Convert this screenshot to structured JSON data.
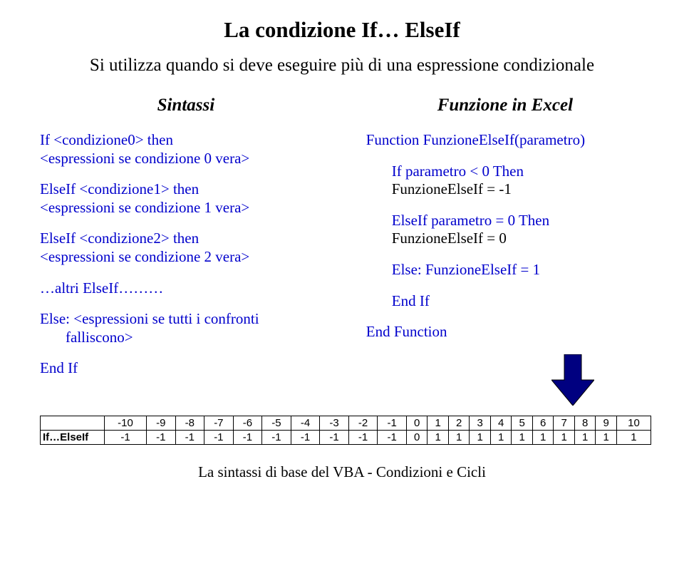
{
  "title": "La condizione If… ElseIf",
  "subtitle": "Si utilizza quando si deve eseguire più di una espressione condizionale",
  "left": {
    "header": "Sintassi",
    "if_then": "If  <condizione0> then",
    "if_body": "<espressioni se condizione 0 vera>",
    "elif1_then": "ElseIf <condizione1> then",
    "elif1_body": "<espressioni se condizione 1 vera>",
    "elif2_then": "ElseIf <condizione2> then",
    "elif2_body": "<espressioni se condizione 2 vera>",
    "others": "…altri ElseIf………",
    "else_kw": "Else:",
    "else_body_l1": " <espressioni se tutti i confronti",
    "else_body_l2": "falliscono>",
    "endif": "End If"
  },
  "right": {
    "header": "Funzione in Excel",
    "fn_decl": "Function FunzioneElseIf(parametro)",
    "if_then": "If parametro < 0 Then",
    "if_body": "FunzioneElseIf = -1",
    "elif_then": "ElseIf parametro = 0 Then",
    "elif_body": "FunzioneElseIf = 0",
    "else_line": "Else: FunzioneElseIf = 1",
    "endif": "End If",
    "end_fn": "End Function"
  },
  "table": {
    "headers": [
      "-10",
      "-9",
      "-8",
      "-7",
      "-6",
      "-5",
      "-4",
      "-3",
      "-2",
      "-1",
      "0",
      "1",
      "2",
      "3",
      "4",
      "5",
      "6",
      "7",
      "8",
      "9",
      "10"
    ],
    "row_label": "If…ElseIf",
    "row_values": [
      "-1",
      "-1",
      "-1",
      "-1",
      "-1",
      "-1",
      "-1",
      "-1",
      "-1",
      "-1",
      "0",
      "1",
      "1",
      "1",
      "1",
      "1",
      "1",
      "1",
      "1",
      "1",
      "1"
    ]
  },
  "footer": "La sintassi di base del VBA - Condizioni e Cicli"
}
